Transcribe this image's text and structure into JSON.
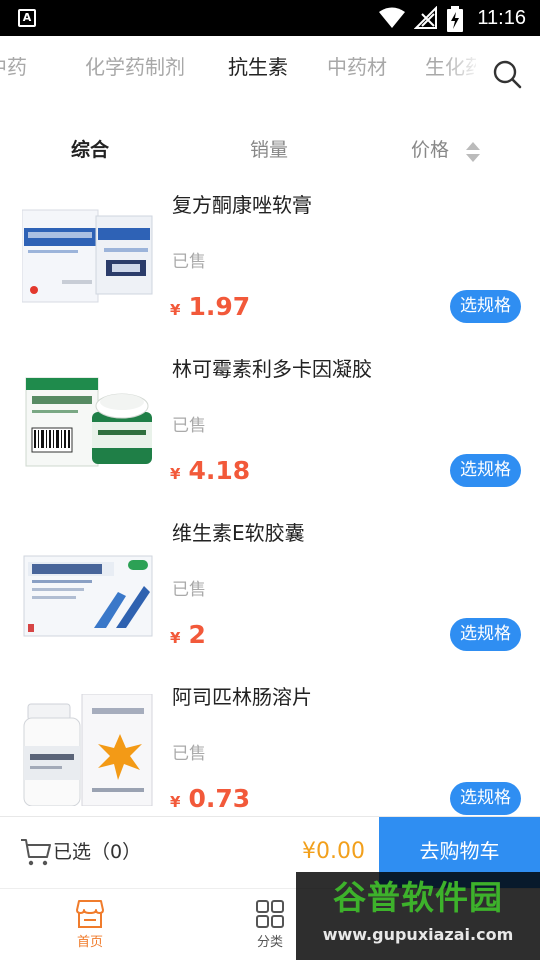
{
  "status_bar": {
    "time": "11:16"
  },
  "categories": [
    {
      "label": "中药"
    },
    {
      "label": "化学药制剂"
    },
    {
      "label": "抗生素"
    },
    {
      "label": "中药材"
    },
    {
      "label": "生化药"
    }
  ],
  "active_category_index": 2,
  "sort": {
    "comprehensive": "综合",
    "sales": "销量",
    "price": "价格",
    "active": "comprehensive"
  },
  "products": [
    {
      "name": "复方酮康唑软膏",
      "sold_label": "已售",
      "currency": "¥",
      "price": "1.97",
      "action_label": "选规格",
      "image": "ointment-box"
    },
    {
      "name": "林可霉素利多卡因凝胶",
      "sold_label": "已售",
      "currency": "¥",
      "price": "4.18",
      "action_label": "选规格",
      "image": "gel-box"
    },
    {
      "name": "维生素E软胶囊",
      "sold_label": "已售",
      "currency": "¥",
      "price": "2",
      "action_label": "选规格",
      "image": "capsule-box"
    },
    {
      "name": "阿司匹林肠溶片",
      "sold_label": "已售",
      "currency": "¥",
      "price": "0.73",
      "action_label": "选规格",
      "image": "tablet-bottle"
    }
  ],
  "cart_bar": {
    "selected_label": "已选",
    "selected_count": "（0）",
    "total": "¥0.00",
    "go_cart_label": "去购物车"
  },
  "tabs": [
    {
      "label": "首页",
      "icon": "home-store-icon",
      "active": true
    },
    {
      "label": "分类",
      "icon": "grid-icon",
      "active": false
    }
  ],
  "watermark": {
    "logo": "谷普软件园",
    "url": "www.gupuxiazai.com"
  },
  "colors": {
    "accent_blue": "#2f8ef2",
    "price_red": "#f2593a",
    "total_orange": "#f2a01c",
    "tab_active": "#f07c2c",
    "inactive_text": "#a8a8a8"
  }
}
